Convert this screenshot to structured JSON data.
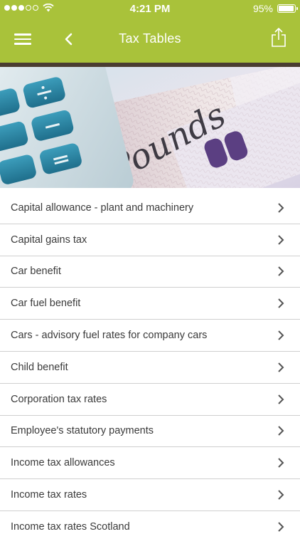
{
  "status_bar": {
    "time": "4:21 PM",
    "battery_text": "95%",
    "battery_level": 0.95,
    "signal_bars": 5,
    "signal_filled": 3,
    "wifi_icon": "wifi-icon"
  },
  "nav": {
    "title": "Tax Tables",
    "menu_icon": "hamburger-menu-icon",
    "back_icon": "chevron-left-icon",
    "share_icon": "share-icon"
  },
  "hero": {
    "alt": "Calculator and pound sterling banknotes",
    "note_text": "Pounds"
  },
  "list": {
    "items": [
      {
        "label": "Capital allowance - plant and machinery"
      },
      {
        "label": "Capital gains tax"
      },
      {
        "label": "Car benefit"
      },
      {
        "label": "Car fuel benefit"
      },
      {
        "label": "Cars - advisory fuel rates for company cars"
      },
      {
        "label": "Child benefit"
      },
      {
        "label": "Corporation tax rates"
      },
      {
        "label": "Employee's statutory payments"
      },
      {
        "label": "Income tax allowances"
      },
      {
        "label": "Income tax rates"
      },
      {
        "label": "Income tax rates Scotland"
      }
    ]
  },
  "colors": {
    "brand_green": "#a9c23a",
    "nav_rule": "#4a3d31",
    "text": "#3a3a3a",
    "divider": "#cfcfcf"
  }
}
